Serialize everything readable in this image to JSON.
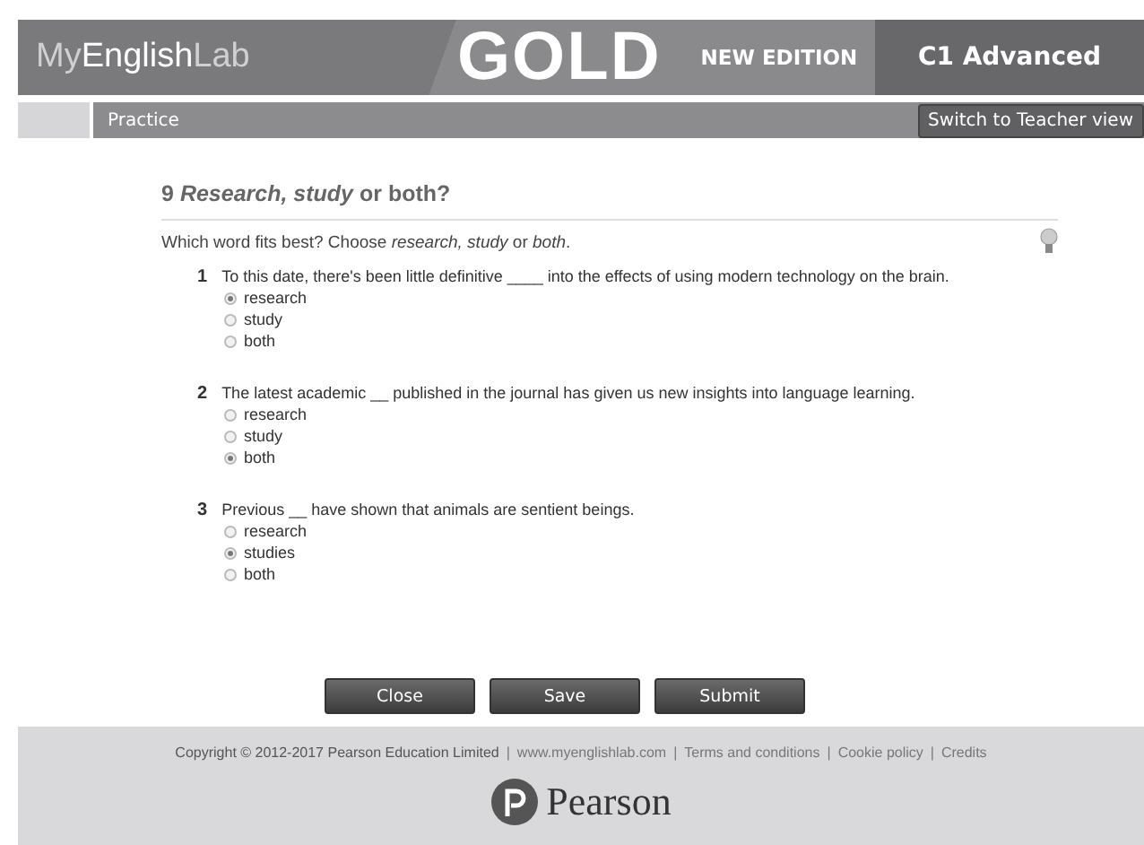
{
  "header": {
    "logo_parts": [
      "My",
      "English",
      "Lab"
    ],
    "brand": "GOLD",
    "edition": "NEW EDITION",
    "level_title": "C1 Advanced"
  },
  "subbar": {
    "label": "Practice",
    "button": "Switch to Teacher view"
  },
  "exercise": {
    "title": "9 *Research, study* or both?",
    "instruction": "Which word fits best? Choose *research, study* or *both*.",
    "questions": [
      {
        "number": "1",
        "text": "To this date, there's been little definitive ____ into the effects of using modern technology on the brain.",
        "options": [
          {
            "label": "research",
            "selected": true
          },
          {
            "label": "study",
            "selected": false
          },
          {
            "label": "both",
            "selected": false
          }
        ]
      },
      {
        "number": "2",
        "text": "The latest academic __ published in the journal has given us new insights into language learning.",
        "options": [
          {
            "label": "research",
            "selected": false
          },
          {
            "label": "study",
            "selected": false
          },
          {
            "label": "both",
            "selected": true
          }
        ]
      },
      {
        "number": "3",
        "text": "Previous __ have shown that animals are sentient beings.",
        "options": [
          {
            "label": "research",
            "selected": false
          },
          {
            "label": "studies",
            "selected": true
          },
          {
            "label": "both",
            "selected": false
          }
        ]
      }
    ]
  },
  "buttons": [
    "Close",
    "Save",
    "Submit"
  ],
  "footer": {
    "items": [
      {
        "kind": "text",
        "text": "Copyright © 2012-2017 Pearson Education Limited"
      },
      {
        "kind": "separator",
        "text": "|"
      },
      {
        "kind": "link",
        "text": "www.myenglishlab.com"
      },
      {
        "kind": "separator",
        "text": "|"
      },
      {
        "kind": "link",
        "text": "Terms and conditions"
      },
      {
        "kind": "separator",
        "text": "|"
      },
      {
        "kind": "link",
        "text": "Cookie policy"
      },
      {
        "kind": "separator",
        "text": "|"
      },
      {
        "kind": "link",
        "text": "Credits"
      }
    ],
    "brand": "Pearson"
  }
}
